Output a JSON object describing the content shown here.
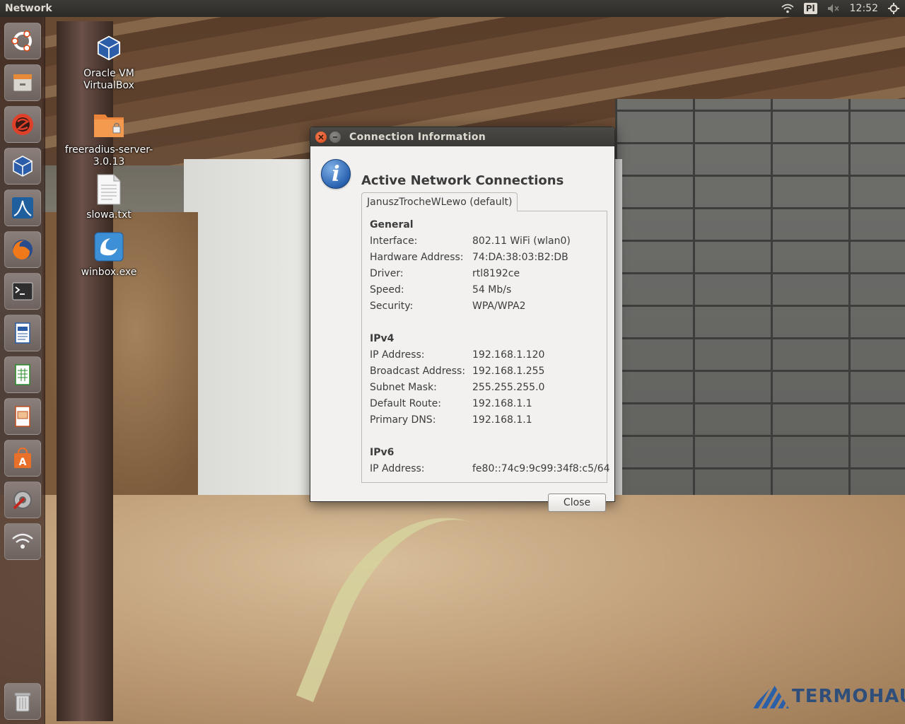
{
  "topbar": {
    "app_title": "Network",
    "keyboard_layout": "Pl",
    "clock": "12:52",
    "icons": [
      "wifi-icon",
      "volume-muted-icon",
      "settings-gear-icon"
    ]
  },
  "launcher": {
    "items": [
      {
        "name": "ubuntu-dash",
        "icon": "ubuntu-logo-icon"
      },
      {
        "name": "files",
        "icon": "drawer-icon"
      },
      {
        "name": "app-red",
        "icon": "red-circle-app-icon"
      },
      {
        "name": "virtualbox",
        "icon": "virtualbox-cube-icon"
      },
      {
        "name": "wireshark",
        "icon": "shark-fin-icon"
      },
      {
        "name": "firefox",
        "icon": "firefox-icon"
      },
      {
        "name": "terminal",
        "icon": "terminal-icon"
      },
      {
        "name": "writer",
        "icon": "document-icon"
      },
      {
        "name": "calc",
        "icon": "spreadsheet-icon"
      },
      {
        "name": "impress",
        "icon": "presentation-icon"
      },
      {
        "name": "software-center",
        "icon": "shopping-bag-icon"
      },
      {
        "name": "system-settings",
        "icon": "wrench-gear-icon"
      },
      {
        "name": "network",
        "icon": "wifi-icon"
      },
      {
        "name": "trash",
        "icon": "trash-icon"
      }
    ]
  },
  "desktop": {
    "icons": [
      {
        "label_line1": "Oracle VM",
        "label_line2": "VirtualBox"
      },
      {
        "label_line1": "freeradius-server-",
        "label_line2": "3.0.13"
      },
      {
        "label_line1": "slowa.txt",
        "label_line2": ""
      },
      {
        "label_line1": "winbox.exe",
        "label_line2": ""
      }
    ],
    "watermark": "TERMOHAUS"
  },
  "dialog": {
    "title": "Connection Information",
    "heading": "Active Network Connections",
    "tab_label": "JanuszTrocheWLewo (default)",
    "general": {
      "section": "General",
      "rows": [
        {
          "key": "Interface:",
          "value": "802.11 WiFi (wlan0)"
        },
        {
          "key": "Hardware Address:",
          "value": "74:DA:38:03:B2:DB"
        },
        {
          "key": "Driver:",
          "value": "rtl8192ce"
        },
        {
          "key": "Speed:",
          "value": "54 Mb/s"
        },
        {
          "key": "Security:",
          "value": "WPA/WPA2"
        }
      ]
    },
    "ipv4": {
      "section": "IPv4",
      "rows": [
        {
          "key": "IP Address:",
          "value": "192.168.1.120"
        },
        {
          "key": "Broadcast Address:",
          "value": "192.168.1.255"
        },
        {
          "key": "Subnet Mask:",
          "value": "255.255.255.0"
        },
        {
          "key": "Default Route:",
          "value": "192.168.1.1"
        },
        {
          "key": "Primary DNS:",
          "value": "192.168.1.1"
        }
      ]
    },
    "ipv6": {
      "section": "IPv6",
      "rows": [
        {
          "key": "IP Address:",
          "value": "fe80::74c9:9c99:34f8:c5/64"
        }
      ]
    },
    "close_label": "Close"
  }
}
